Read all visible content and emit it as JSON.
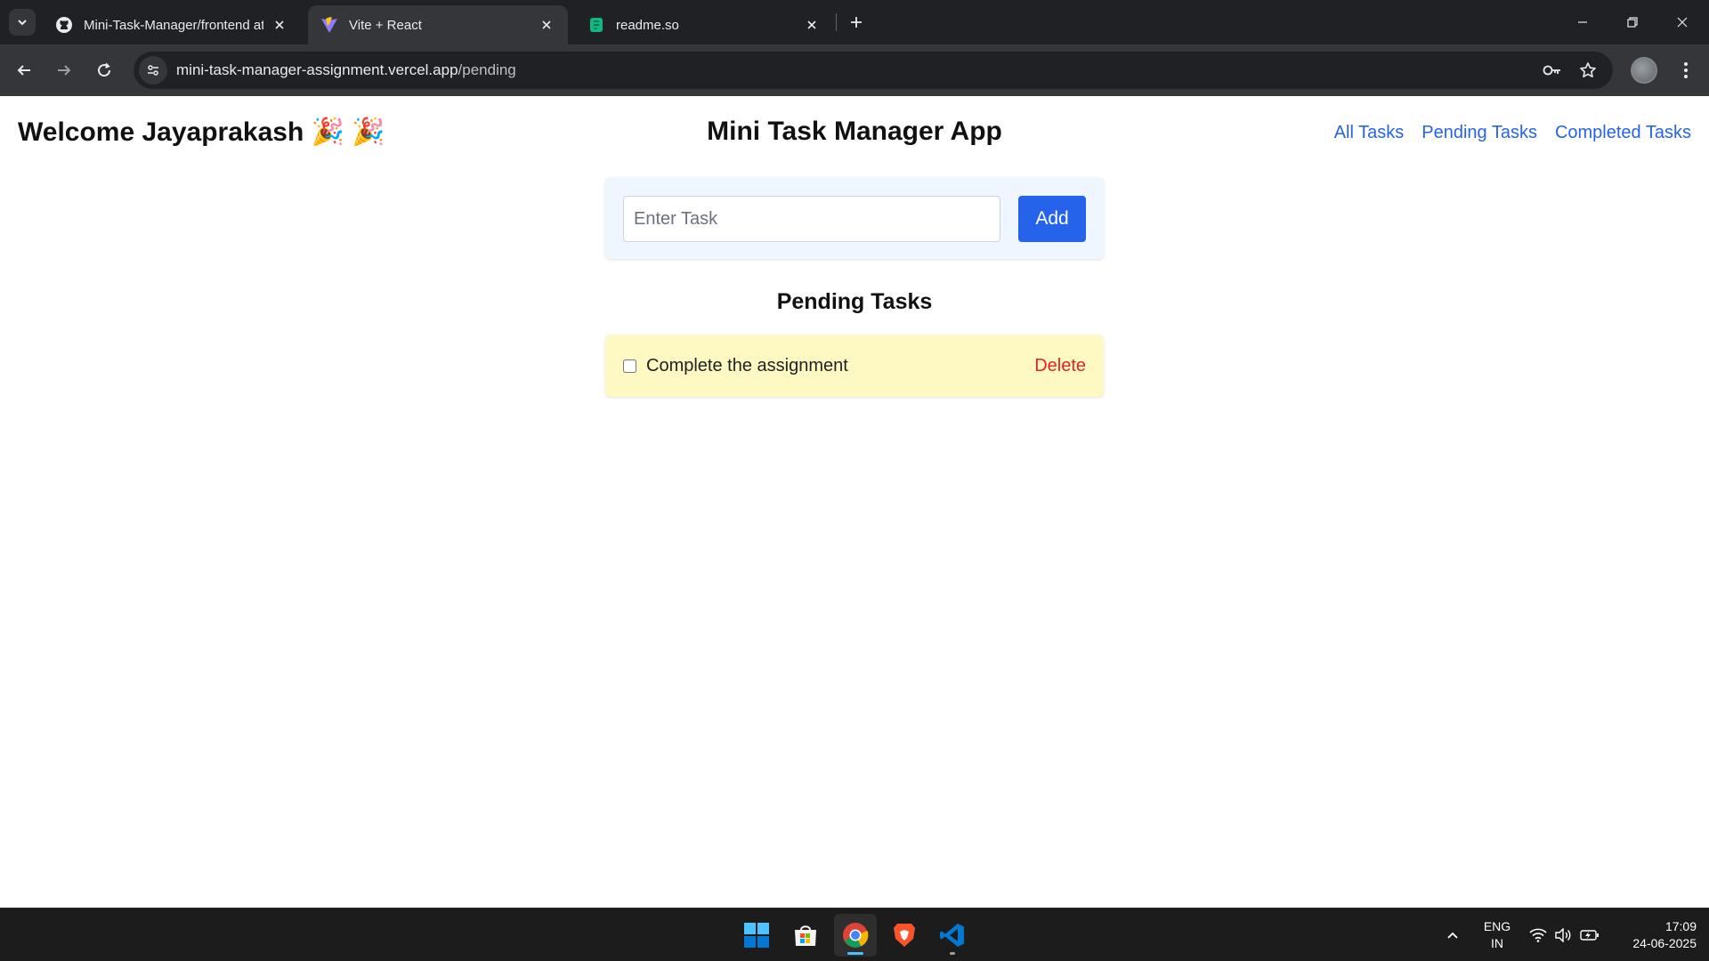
{
  "browser": {
    "tabs": [
      {
        "title": "Mini-Task-Manager/frontend at",
        "favicon": "github-icon",
        "active": false
      },
      {
        "title": "Vite + React",
        "favicon": "vite-icon",
        "active": true
      },
      {
        "title": "readme.so",
        "favicon": "readme-icon",
        "active": false
      }
    ],
    "url_host": "mini-task-manager-assignment.vercel.app",
    "url_path": "/pending"
  },
  "header": {
    "welcome_text": "Welcome Jayaprakash",
    "welcome_emoji": "🎉 🎉",
    "app_title": "Mini Task Manager App",
    "nav": {
      "all": "All Tasks",
      "pending": "Pending Tasks",
      "completed": "Completed Tasks"
    }
  },
  "add_form": {
    "placeholder": "Enter Task",
    "value": "",
    "button_label": "Add"
  },
  "section_title": "Pending Tasks",
  "tasks": [
    {
      "text": "Complete the assignment",
      "completed": false,
      "delete_label": "Delete"
    }
  ],
  "colors": {
    "primary": "#2563eb",
    "danger": "#dc2626",
    "pending_bg": "#fef9c3",
    "form_bg": "#eff6ff"
  },
  "taskbar": {
    "lang_line1": "ENG",
    "lang_line2": "IN",
    "time": "17:09",
    "date": "24-06-2025"
  }
}
